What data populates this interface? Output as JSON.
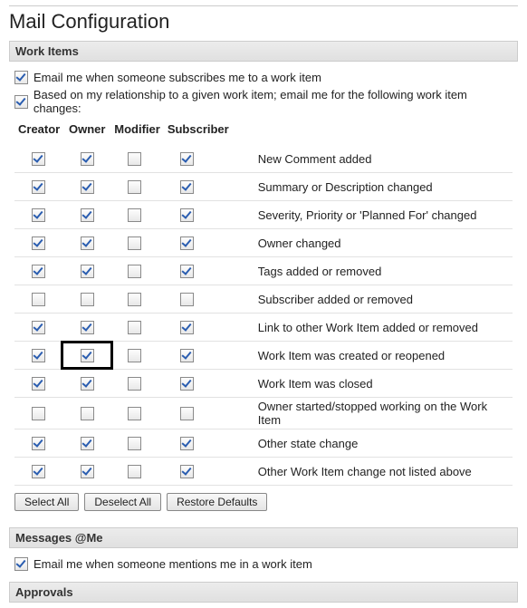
{
  "title": "Mail Configuration",
  "sections": {
    "work_items": {
      "header": "Work Items",
      "opt_subscribe": {
        "checked": true,
        "label": "Email me when someone subscribes me to a work item"
      },
      "opt_relationship": {
        "checked": true,
        "label": "Based on my relationship to a given work item; email me for the following work item changes:"
      },
      "columns": {
        "creator": "Creator",
        "owner": "Owner",
        "modifier": "Modifier",
        "subscriber": "Subscriber"
      },
      "rows": [
        {
          "creator": true,
          "owner": true,
          "modifier": false,
          "subscriber": true,
          "label": "New Comment added",
          "hl": null
        },
        {
          "creator": true,
          "owner": true,
          "modifier": false,
          "subscriber": true,
          "label": "Summary or Description changed",
          "hl": null
        },
        {
          "creator": true,
          "owner": true,
          "modifier": false,
          "subscriber": true,
          "label": "Severity, Priority or 'Planned For' changed",
          "hl": null
        },
        {
          "creator": true,
          "owner": true,
          "modifier": false,
          "subscriber": true,
          "label": "Owner changed",
          "hl": null
        },
        {
          "creator": true,
          "owner": true,
          "modifier": false,
          "subscriber": true,
          "label": "Tags added or removed",
          "hl": null
        },
        {
          "creator": false,
          "owner": false,
          "modifier": false,
          "subscriber": false,
          "label": "Subscriber added or removed",
          "hl": null
        },
        {
          "creator": true,
          "owner": true,
          "modifier": false,
          "subscriber": true,
          "label": "Link to other Work Item added or removed",
          "hl": null
        },
        {
          "creator": true,
          "owner": true,
          "modifier": false,
          "subscriber": true,
          "label": "Work Item was created or reopened",
          "hl": "owner"
        },
        {
          "creator": true,
          "owner": true,
          "modifier": false,
          "subscriber": true,
          "label": "Work Item was closed",
          "hl": null
        },
        {
          "creator": false,
          "owner": false,
          "modifier": false,
          "subscriber": false,
          "label": "Owner started/stopped working on the Work Item",
          "hl": null
        },
        {
          "creator": true,
          "owner": true,
          "modifier": false,
          "subscriber": true,
          "label": "Other state change",
          "hl": null
        },
        {
          "creator": true,
          "owner": true,
          "modifier": false,
          "subscriber": true,
          "label": "Other Work Item change not listed above",
          "hl": null
        }
      ],
      "buttons": {
        "select_all": "Select All",
        "deselect_all": "Deselect All",
        "restore": "Restore Defaults"
      }
    },
    "messages_me": {
      "header": "Messages @Me",
      "opt_mention": {
        "checked": true,
        "label": "Email me when someone mentions me in a work item"
      }
    },
    "approvals": {
      "header": "Approvals"
    }
  }
}
